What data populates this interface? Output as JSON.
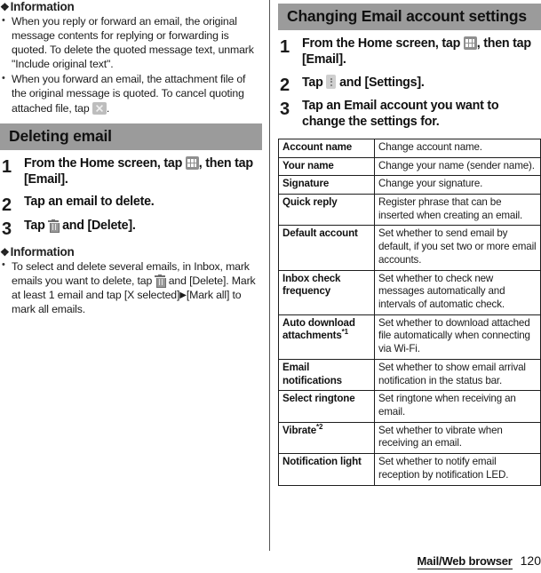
{
  "left_column": {
    "info_top": {
      "heading": "Information",
      "diamond": "❖",
      "bullets": [
        {
          "segments": [
            {
              "t": "text",
              "v": "When you reply or forward an email, the original message contents for replying or forwarding is quoted. To delete the quoted message text, unmark \"Include original text\"."
            }
          ]
        },
        {
          "segments": [
            {
              "t": "text",
              "v": "When you forward an email, the attachment file of the original message is quoted. To cancel quoting attached file, tap "
            },
            {
              "t": "icon",
              "v": "close-icon"
            },
            {
              "t": "text",
              "v": "."
            }
          ]
        }
      ]
    },
    "section": {
      "title": "Deleting email",
      "steps": [
        {
          "num": "1",
          "segments": [
            {
              "t": "text",
              "v": "From the Home screen, tap "
            },
            {
              "t": "icon",
              "v": "apps-grid-icon"
            },
            {
              "t": "text",
              "v": ", then tap [Email]."
            }
          ]
        },
        {
          "num": "2",
          "segments": [
            {
              "t": "text",
              "v": "Tap an email to delete."
            }
          ]
        },
        {
          "num": "3",
          "segments": [
            {
              "t": "text",
              "v": "Tap "
            },
            {
              "t": "icon",
              "v": "trash-icon"
            },
            {
              "t": "text",
              "v": " and [Delete]."
            }
          ]
        }
      ]
    },
    "info_bottom": {
      "heading": "Information",
      "diamond": "❖",
      "bullets": [
        {
          "segments": [
            {
              "t": "text",
              "v": "To select and delete several emails, in Inbox, mark emails you want to delete, tap "
            },
            {
              "t": "icon",
              "v": "trash-icon"
            },
            {
              "t": "text",
              "v": " and [Delete]. Mark at least 1 email and tap [X selected]"
            },
            {
              "t": "icon",
              "v": "triangle-right-icon"
            },
            {
              "t": "text",
              "v": "[Mark all] to mark all emails."
            }
          ]
        }
      ]
    }
  },
  "right_column": {
    "section": {
      "title": "Changing Email account settings",
      "steps": [
        {
          "num": "1",
          "segments": [
            {
              "t": "text",
              "v": "From the Home screen, tap "
            },
            {
              "t": "icon",
              "v": "apps-grid-icon"
            },
            {
              "t": "text",
              "v": ", then tap [Email]."
            }
          ]
        },
        {
          "num": "2",
          "segments": [
            {
              "t": "text",
              "v": "Tap "
            },
            {
              "t": "icon",
              "v": "overflow-menu-icon"
            },
            {
              "t": "text",
              "v": " and [Settings]."
            }
          ]
        },
        {
          "num": "3",
          "segments": [
            {
              "t": "text",
              "v": "Tap an Email account you want to change the settings for."
            }
          ]
        }
      ]
    },
    "settings_table": {
      "rows": [
        {
          "key": "Account name",
          "key_sup": "",
          "value": "Change account name."
        },
        {
          "key": "Your name",
          "key_sup": "",
          "value": "Change your name (sender name)."
        },
        {
          "key": "Signature",
          "key_sup": "",
          "value": "Change your signature."
        },
        {
          "key": "Quick reply",
          "key_sup": "",
          "value": "Register phrase that can be inserted when creating an email."
        },
        {
          "key": "Default account",
          "key_sup": "",
          "value": "Set whether to send email by default, if you set two or more email accounts."
        },
        {
          "key": "Inbox check frequency",
          "key_sup": "",
          "value": "Set whether to check new messages automatically and intervals of automatic check."
        },
        {
          "key": "Auto download attachments",
          "key_sup": "*1",
          "value": "Set whether to download attached file automatically when connecting via Wi-Fi."
        },
        {
          "key": "Email notifications",
          "key_sup": "",
          "value": "Set whether to show email arrival notification in the status bar."
        },
        {
          "key": "Select ringtone",
          "key_sup": "",
          "value": "Set ringtone when receiving an email."
        },
        {
          "key": "Vibrate",
          "key_sup": "*2",
          "value": "Set whether to vibrate when receiving an email."
        },
        {
          "key": "Notification light",
          "key_sup": "",
          "value": "Set whether to notify email reception by notification LED."
        }
      ]
    }
  },
  "footer": {
    "chapter": "Mail/Web browser",
    "page_number": "120"
  },
  "colors": {
    "section_header_bg": "#9b9b9b",
    "text": "#1a1a1a",
    "table_border": "#1e1e1e",
    "divider": "#555555"
  }
}
